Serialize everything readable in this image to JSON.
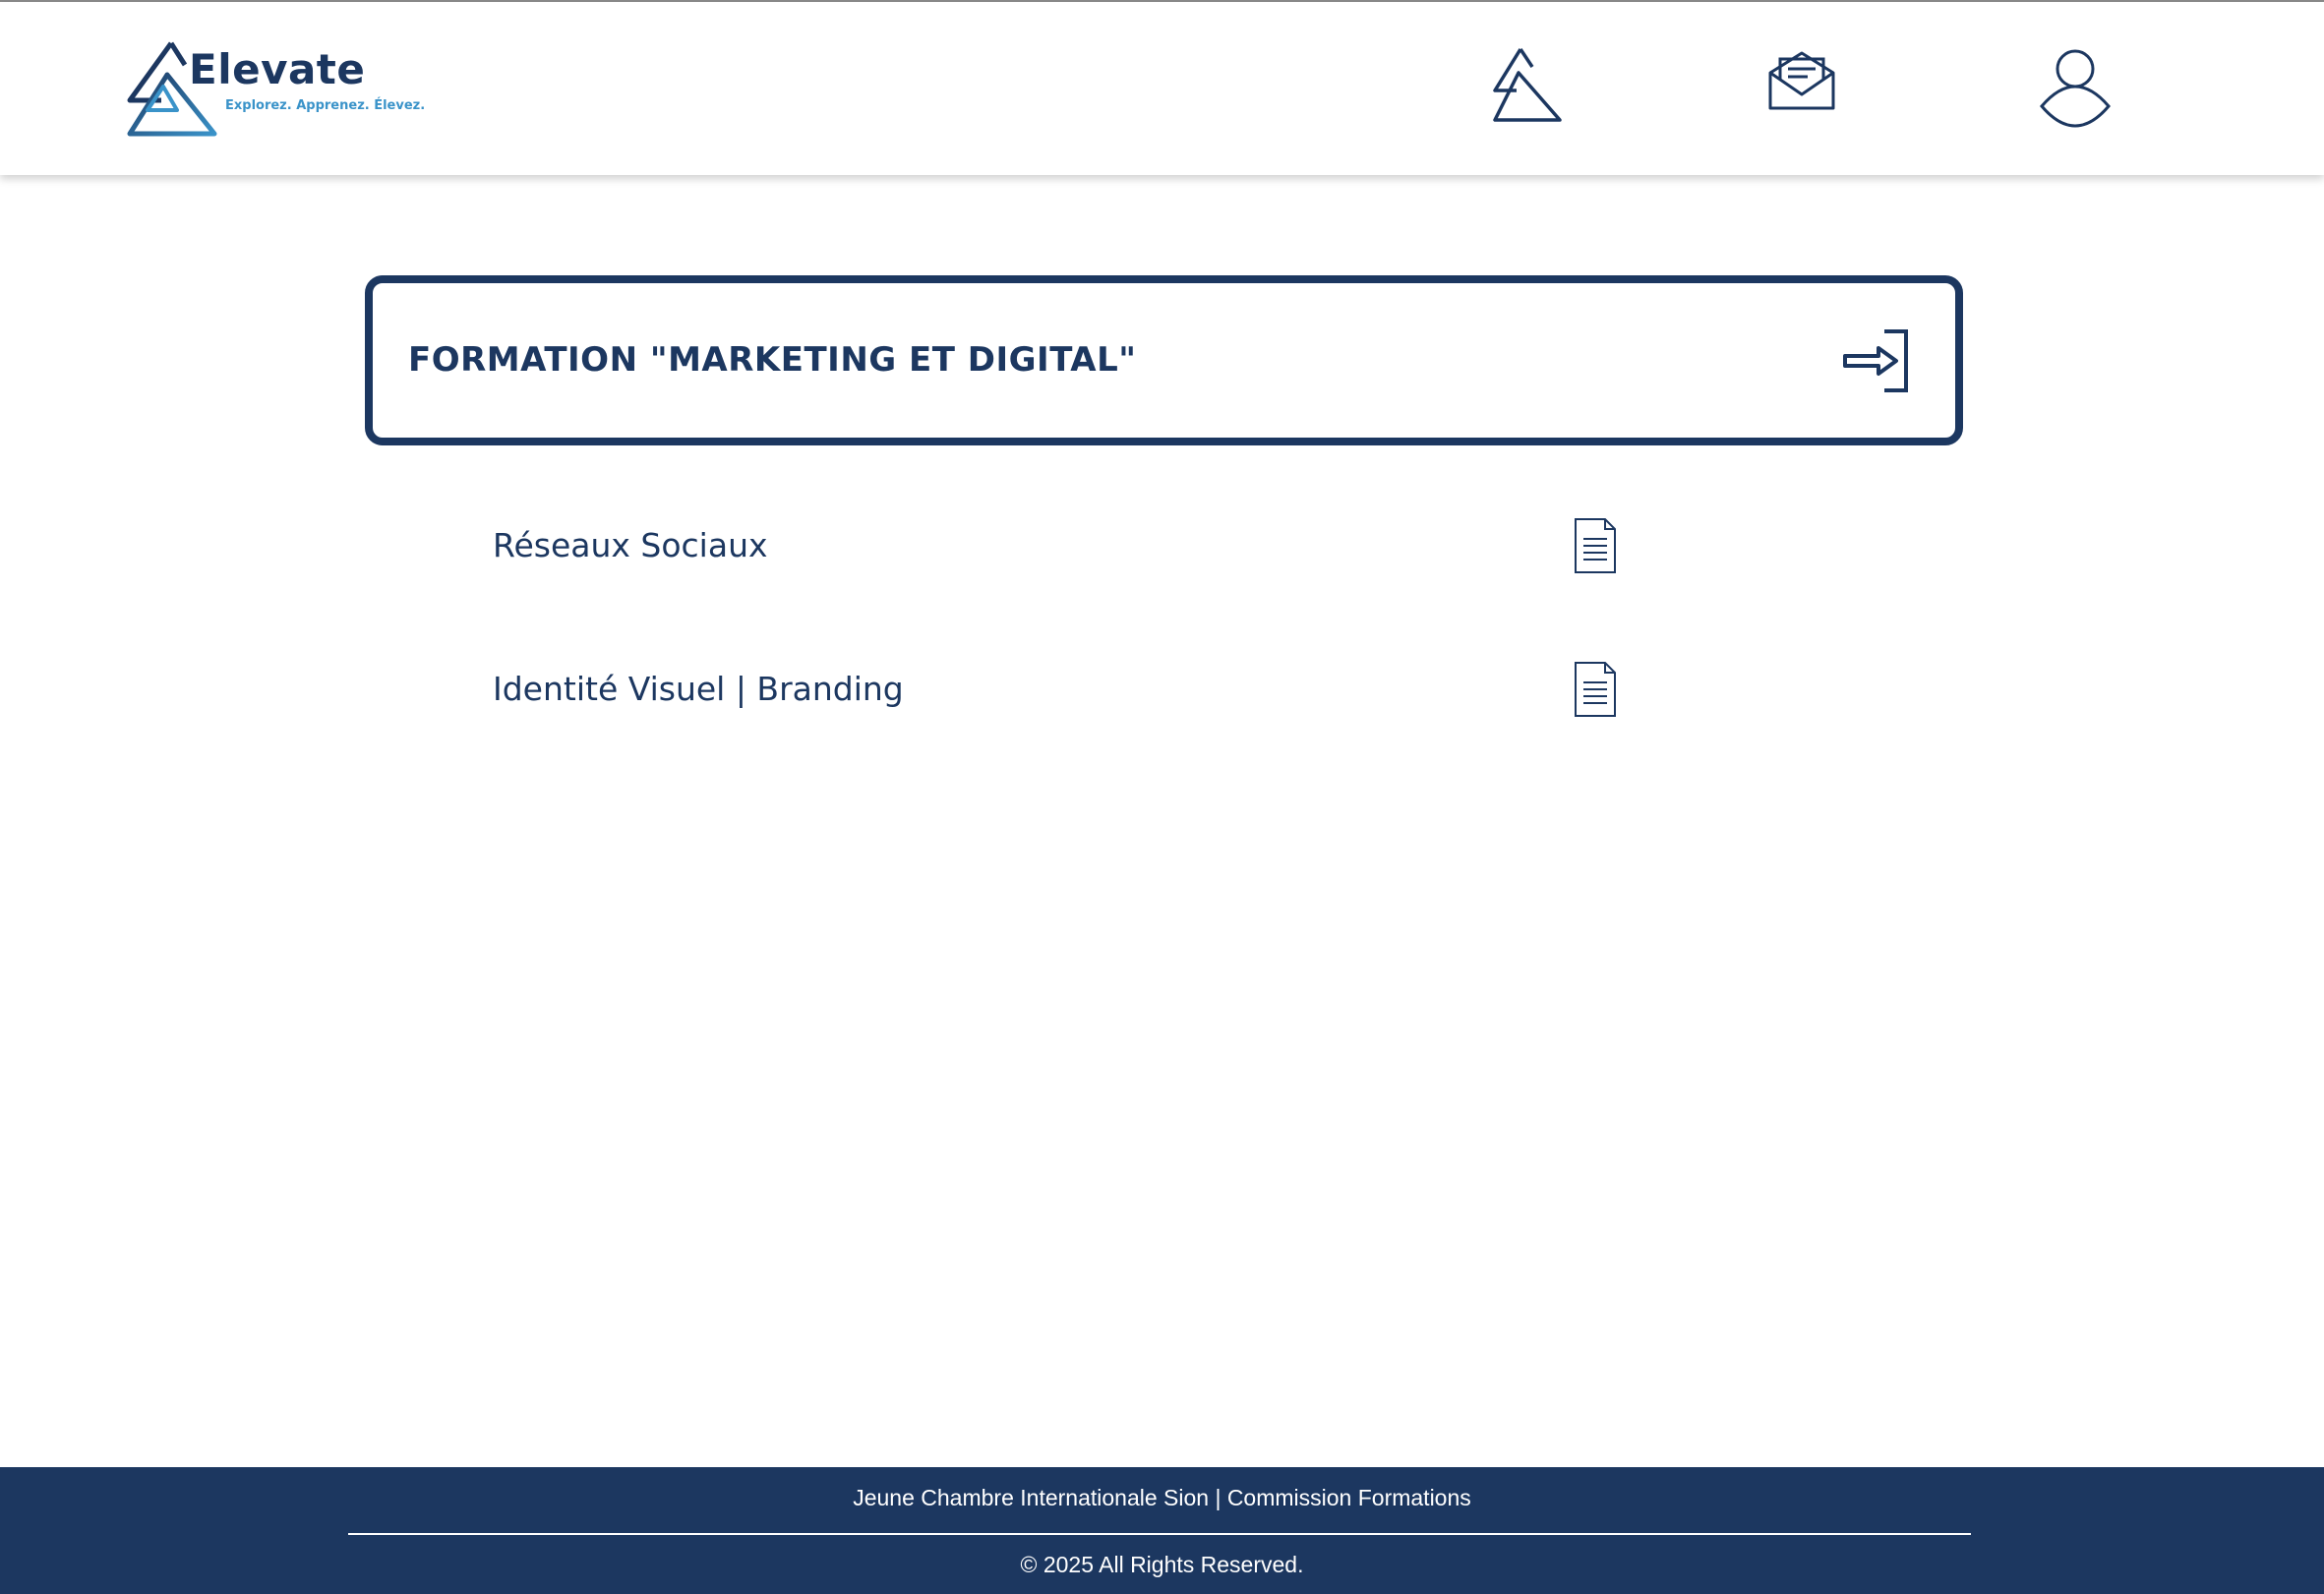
{
  "header": {
    "logo": {
      "name": "Elevate",
      "tagline": "Explorez. Apprenez. Élevez."
    },
    "nav_icons": [
      "elevate-triangle-icon",
      "envelope-icon",
      "user-icon"
    ]
  },
  "course": {
    "title": "FORMATION \"MARKETING ET DIGITAL\"",
    "action_icon": "enter-arrow-icon"
  },
  "lessons": [
    {
      "title": "Réseaux Sociaux",
      "icon": "document-icon"
    },
    {
      "title": "Identité Visuel | Branding",
      "icon": "document-icon"
    }
  ],
  "footer": {
    "organization": "Jeune Chambre Internationale Sion | Commission Formations",
    "copyright": "© 2025 All Rights Reserved."
  },
  "colors": {
    "primary": "#1c3760",
    "accent": "#3a93c9",
    "background": "#ffffff"
  }
}
